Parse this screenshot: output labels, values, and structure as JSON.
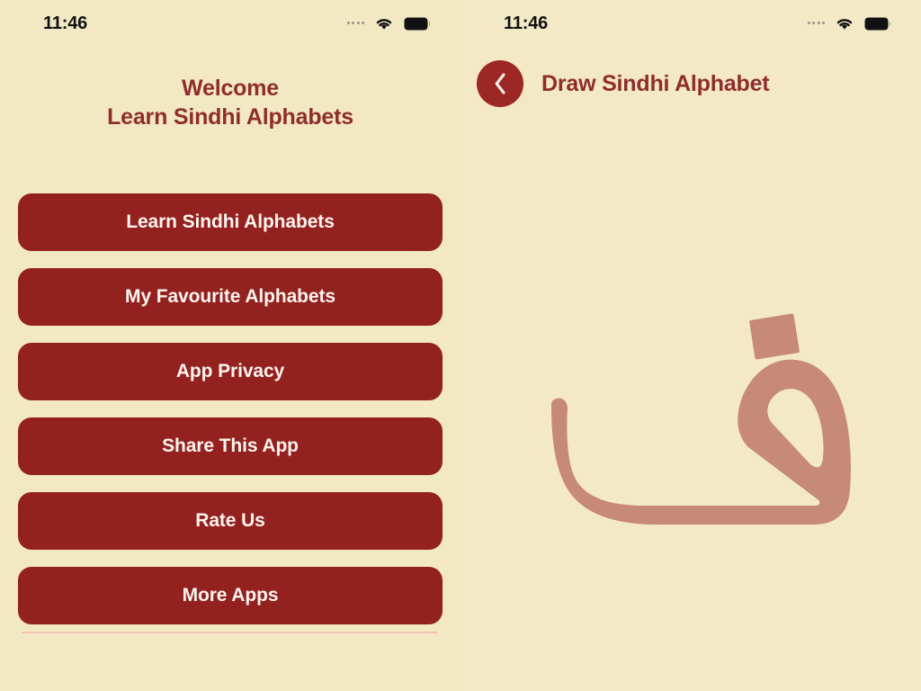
{
  "app": {
    "background_color": "#f2e8c4",
    "brand_color": "#92211f",
    "title_color": "#8f2d2d",
    "glyph_color": "#c6897a"
  },
  "left_screen": {
    "status_bar": {
      "time": "11:46",
      "signal_icon": "signal-dots-icon",
      "wifi_icon": "wifi-icon",
      "battery_icon": "battery-full-icon"
    },
    "header": {
      "line1": "Welcome",
      "line2": "Learn Sindhi Alphabets"
    },
    "menu": {
      "items": [
        {
          "label": "Learn Sindhi Alphabets",
          "name": "menu-learn-sindhi-alphabets"
        },
        {
          "label": "My Favourite Alphabets",
          "name": "menu-my-favourite-alphabets"
        },
        {
          "label": "App Privacy",
          "name": "menu-app-privacy"
        },
        {
          "label": "Share This App",
          "name": "menu-share-this-app"
        },
        {
          "label": "Rate Us",
          "name": "menu-rate-us"
        },
        {
          "label": "More Apps",
          "name": "menu-more-apps"
        }
      ]
    }
  },
  "right_screen": {
    "status_bar": {
      "time": "11:46",
      "signal_icon": "signal-dots-icon",
      "wifi_icon": "wifi-icon",
      "battery_icon": "battery-full-icon"
    },
    "header": {
      "back_icon": "chevron-left-icon",
      "title": "Draw Sindhi Alphabet"
    },
    "canvas": {
      "letter_name": "arabic-letter-feh",
      "letter": "ف",
      "stroke_color": "#c6897a",
      "dot_shape": "square"
    }
  }
}
